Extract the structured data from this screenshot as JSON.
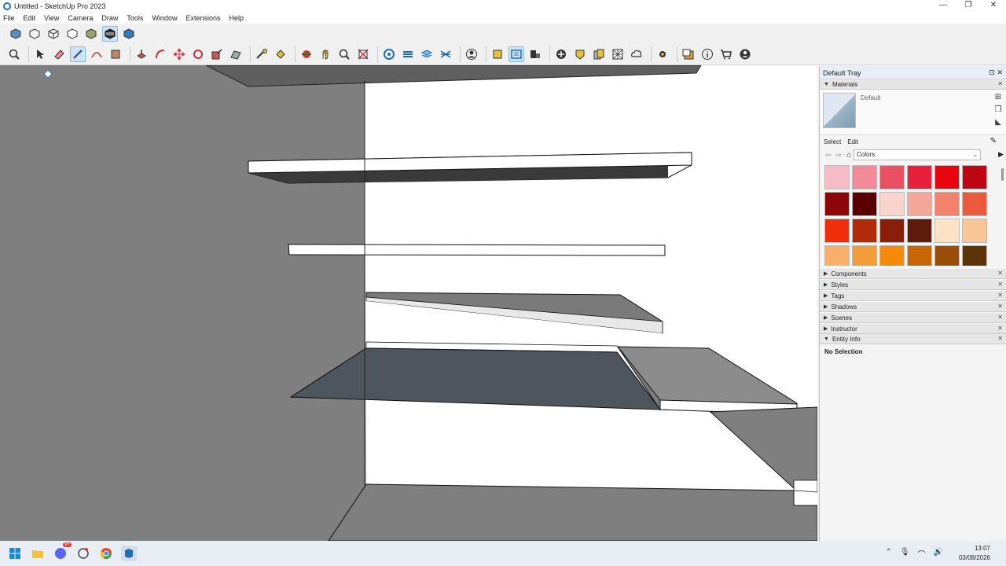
{
  "window": {
    "title": "Untitled - SketchUp Pro 2023",
    "controls": [
      "—",
      "❐",
      "✕"
    ]
  },
  "menu": [
    "File",
    "Edit",
    "View",
    "Camera",
    "Draw",
    "Tools",
    "Window",
    "Extensions",
    "Help"
  ],
  "tray": {
    "title": "Default Tray",
    "materials": {
      "title": "Materials",
      "current": "Default",
      "tabs": [
        "Select",
        "Edit"
      ],
      "collection": "Colors",
      "swatches": [
        "#f7bcc6",
        "#f28a97",
        "#ea4f62",
        "#e7213c",
        "#e8050f",
        "#bf0614",
        "#8e0509",
        "#5a0000",
        "#f8d4cc",
        "#f2a799",
        "#f2836a",
        "#ec5a3d",
        "#f02f0a",
        "#b22a08",
        "#8a1e0a",
        "#5e1b0a",
        "#fde2c6",
        "#f9c496",
        "#f7b06b",
        "#f29d37",
        "#f58a0a",
        "#c86505",
        "#9a4e08",
        "#5c3407"
      ]
    },
    "collapsed_panels": [
      "Components",
      "Styles",
      "Tags",
      "Shadows",
      "Scenes",
      "Instructor"
    ],
    "entity_info": {
      "title": "Entity Info",
      "status": "No Selection"
    }
  },
  "taskbar": {
    "time": "13:07",
    "date": "03/08/2026",
    "discord_badge": "9+"
  },
  "colors": {
    "viewport_bg": "#ffffff",
    "left_wall": "#7f7f7f",
    "dark_face": "#4d565c",
    "side_face": "#8c8c8c",
    "selection_blue": "#cde3f7"
  }
}
